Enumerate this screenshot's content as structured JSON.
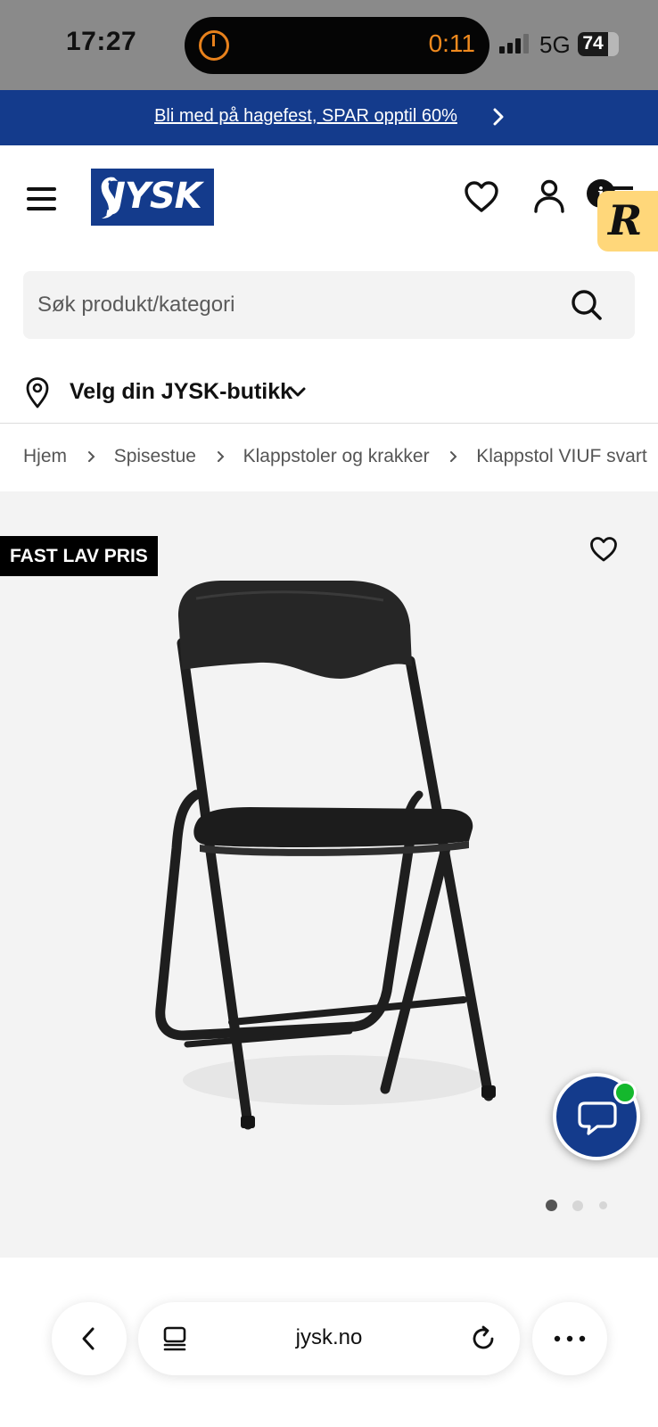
{
  "status_bar": {
    "time": "17:27",
    "timer": "0:11",
    "network": "5G",
    "battery": "74",
    "battery_level": 0.74
  },
  "promo": {
    "text": "Bli med på hagefest, SPAR opptil 60%"
  },
  "header": {
    "logo_text": "JYSK",
    "info_badge": "i",
    "extension_badge": "R"
  },
  "search": {
    "placeholder": "Søk produkt/kategori"
  },
  "store_selector": {
    "label": "Velg din JYSK-butikk"
  },
  "breadcrumb": [
    "Hjem",
    "Spisestue",
    "Klappstoler og krakker",
    "Klappstol VIUF svart"
  ],
  "product": {
    "badge": "FAST LAV PRIS",
    "image_count": 3,
    "active_image": 1
  },
  "browser": {
    "url": "jysk.no"
  },
  "colors": {
    "brand_blue": "#143b8c",
    "online_green": "#14b82d",
    "timer_orange": "#f08a1e",
    "badge_yellow": "#ffd77a"
  },
  "icons": {
    "menu": "hamburger-menu-icon",
    "wishlist": "heart-icon",
    "account": "user-icon",
    "search": "search-icon",
    "store": "location-pin-icon",
    "chat": "chat-bubble-icon",
    "back": "chevron-left-icon",
    "tabs": "tabs-icon",
    "reload": "reload-icon",
    "more": "more-dots-icon"
  }
}
